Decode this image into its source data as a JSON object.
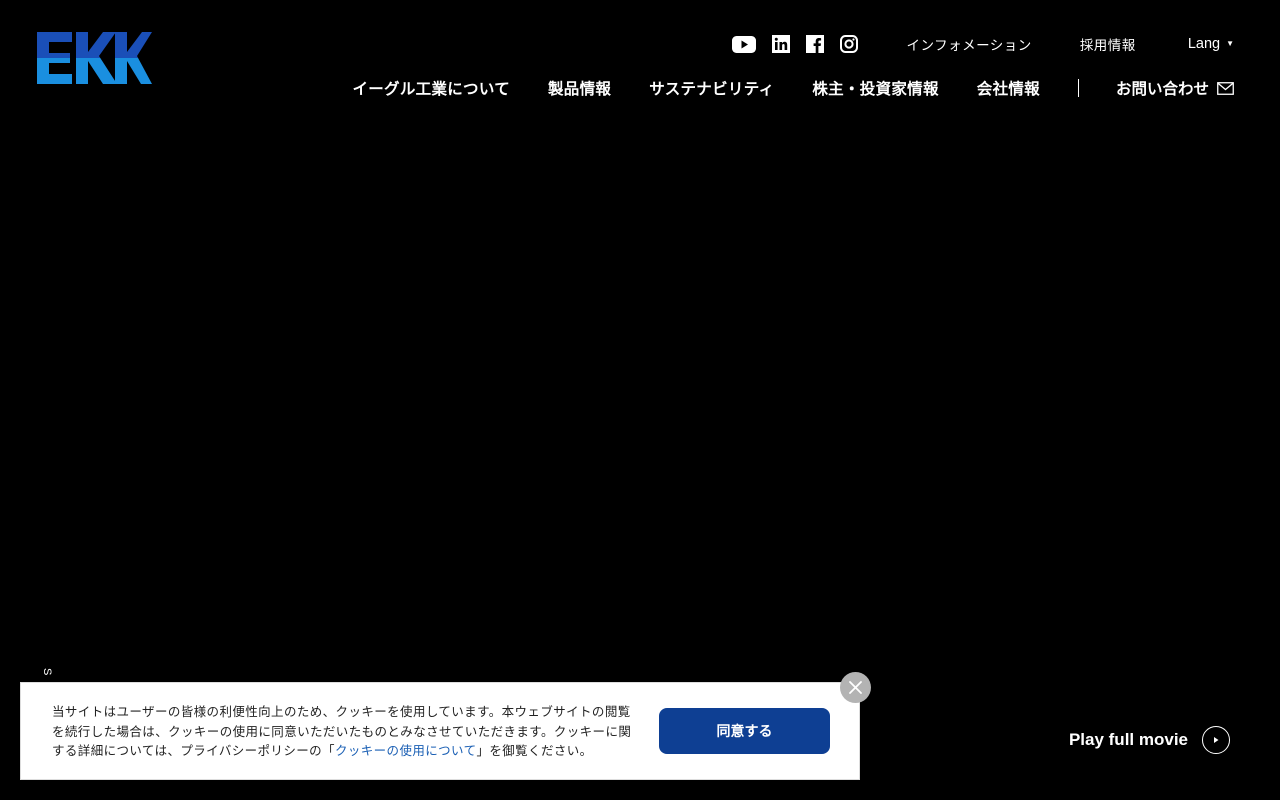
{
  "logo": {
    "text": "EKK",
    "colors": {
      "top": "#1a4fb8",
      "bottom": "#1a8fe0"
    }
  },
  "social": [
    {
      "name": "youtube-icon"
    },
    {
      "name": "linkedin-icon"
    },
    {
      "name": "facebook-icon"
    },
    {
      "name": "instagram-icon"
    }
  ],
  "utility_nav": {
    "information": "インフォメーション",
    "recruit": "採用情報",
    "lang": "Lang",
    "lang_caret": "▼"
  },
  "main_nav": {
    "about": "イーグル工業について",
    "products": "製品情報",
    "sustainability": "サステナビリティ",
    "investors": "株主・投資家情報",
    "company": "会社情報",
    "contact": "お問い合わせ"
  },
  "scroll_indicator": "S",
  "cookie": {
    "text_before": "当サイトはユーザーの皆様の利便性向上のため、クッキーを使用しています。本ウェブサイトの閲覧を続行した場合は、クッキーの使用に同意いただいたものとみなさせていただきます。クッキーに関する詳細については、プライバシーポリシーの「",
    "link": "クッキーの使用について",
    "text_after": "」を御覧ください。",
    "agree_label": "同意する",
    "accent_color": "#0e3f93"
  },
  "video": {
    "play_label": "Play full movie"
  }
}
